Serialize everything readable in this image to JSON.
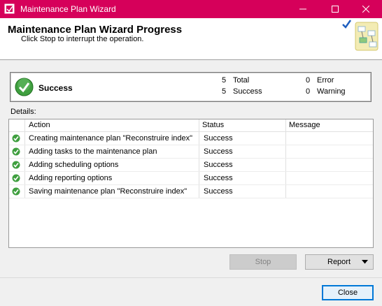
{
  "window": {
    "title": "Maintenance Plan Wizard",
    "icon": "wizard-app-icon",
    "controls": [
      "minimize-icon",
      "maximize-icon",
      "close-icon"
    ]
  },
  "header": {
    "title": "Maintenance Plan Wizard Progress",
    "subtitle": "Click Stop to interrupt the operation."
  },
  "summary": {
    "status": "Success",
    "total_count": "5",
    "total_label": "Total",
    "success_count": "5",
    "success_label": "Success",
    "error_count": "0",
    "error_label": "Error",
    "warning_count": "0",
    "warning_label": "Warning"
  },
  "details": {
    "label": "Details:",
    "columns": [
      "Action",
      "Status",
      "Message"
    ],
    "rows": [
      {
        "action": "Creating maintenance plan \"Reconstruire index\"",
        "status": "Success",
        "message": ""
      },
      {
        "action": "Adding tasks to the maintenance plan",
        "status": "Success",
        "message": ""
      },
      {
        "action": "Adding scheduling options",
        "status": "Success",
        "message": ""
      },
      {
        "action": "Adding reporting options",
        "status": "Success",
        "message": ""
      },
      {
        "action": "Saving maintenance plan \"Reconstruire index\"",
        "status": "Success",
        "message": ""
      }
    ]
  },
  "buttons": {
    "stop": "Stop",
    "report": "Report",
    "close": "Close"
  },
  "colors": {
    "titlebar": "#d6005a",
    "success_green": "#2e9a2e",
    "focus_blue": "#0078d7"
  }
}
